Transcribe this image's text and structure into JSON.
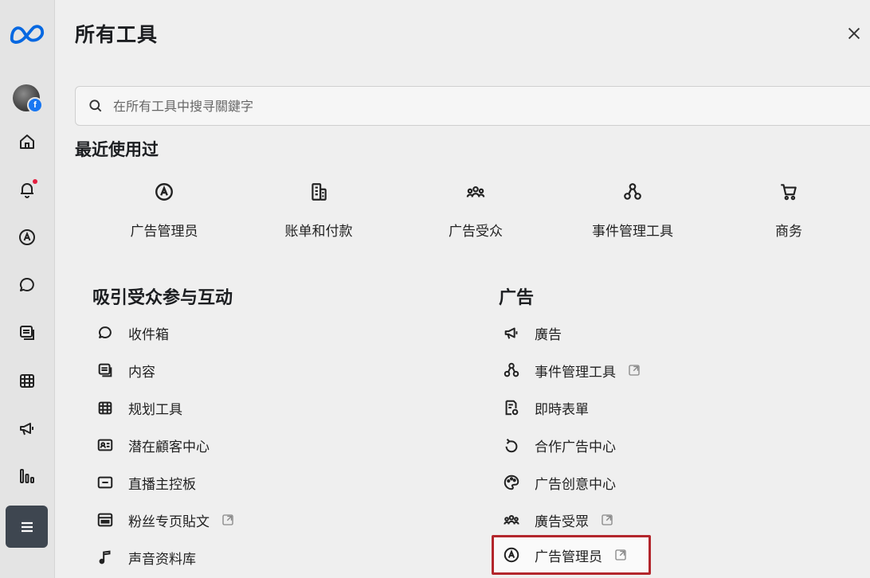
{
  "panel": {
    "title": "所有工具",
    "search_placeholder": "在所有工具中搜寻關鍵字"
  },
  "recent": {
    "title": "最近使用过",
    "items": [
      {
        "label": "广告管理员",
        "icon": "ads-manager-icon"
      },
      {
        "label": "账单和付款",
        "icon": "billing-icon"
      },
      {
        "label": "广告受众",
        "icon": "audience-icon"
      },
      {
        "label": "事件管理工具",
        "icon": "events-manager-icon"
      },
      {
        "label": "商务",
        "icon": "cart-icon"
      }
    ]
  },
  "engage": {
    "title": "吸引受众参与互动",
    "items": [
      {
        "label": "收件箱",
        "icon": "inbox-icon",
        "external": false
      },
      {
        "label": "内容",
        "icon": "content-icon",
        "external": false
      },
      {
        "label": "规划工具",
        "icon": "planner-icon",
        "external": false
      },
      {
        "label": "潜在顧客中心",
        "icon": "leads-center-icon",
        "external": false
      },
      {
        "label": "直播主控板",
        "icon": "live-dashboard-icon",
        "external": false
      },
      {
        "label": "粉丝专页貼文",
        "icon": "page-posts-icon",
        "external": true
      },
      {
        "label": "声音资料库",
        "icon": "music-icon",
        "external": false
      }
    ]
  },
  "ads": {
    "title": "广告",
    "items": [
      {
        "label": "廣告",
        "icon": "megaphone-icon",
        "external": false
      },
      {
        "label": "事件管理工具",
        "icon": "events-manager-icon",
        "external": true
      },
      {
        "label": "即時表單",
        "icon": "instant-forms-icon",
        "external": false
      },
      {
        "label": "合作广告中心",
        "icon": "partnership-ads-icon",
        "external": false
      },
      {
        "label": "广告创意中心",
        "icon": "creative-hub-icon",
        "external": false
      },
      {
        "label": "廣告受眾",
        "icon": "audience-icon",
        "external": true
      },
      {
        "label": "广告管理员",
        "icon": "ads-manager-icon",
        "external": true
      }
    ]
  },
  "colors": {
    "brand": "#0668e1",
    "highlight": "#b3262c",
    "notification": "#e41e3f"
  }
}
